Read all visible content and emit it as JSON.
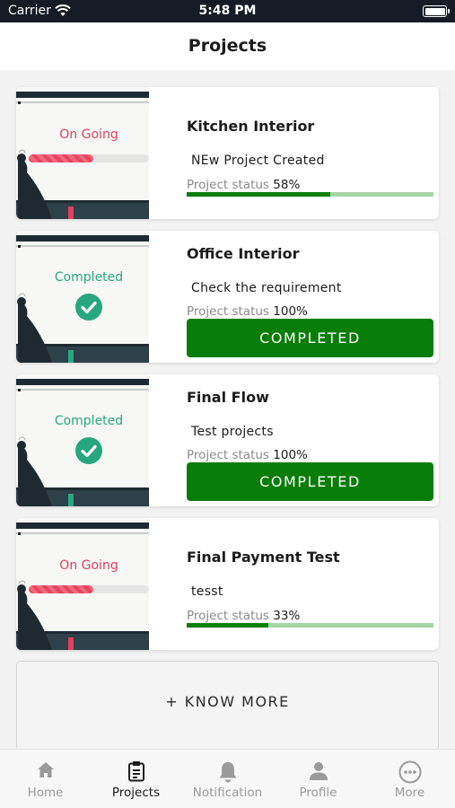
{
  "status_bar": {
    "carrier": "Carrier",
    "time": "5:48 PM"
  },
  "header": {
    "title": "Projects"
  },
  "status_label": "Project status",
  "projects": [
    {
      "title": "Kitchen Interior",
      "description": "NEw Project Created",
      "state": "On Going",
      "percent_text": "58%",
      "progress": 0.58,
      "completed": false
    },
    {
      "title": "Office Interior",
      "description": "Check the requirement",
      "state": "Completed",
      "percent_text": "100%",
      "progress": 1.0,
      "completed": true,
      "button_label": "COMPLETED"
    },
    {
      "title": "Final Flow",
      "description": "Test projects",
      "state": "Completed",
      "percent_text": "100%",
      "progress": 1.0,
      "completed": true,
      "button_label": "COMPLETED"
    },
    {
      "title": "Final Payment Test",
      "description": "tesst",
      "state": "On Going",
      "percent_text": "33%",
      "progress": 0.33,
      "completed": false
    }
  ],
  "know_more": {
    "label": "+ KNOW MORE"
  },
  "tabs": [
    {
      "label": "Home",
      "icon": "home-icon",
      "active": false
    },
    {
      "label": "Projects",
      "icon": "clipboard-icon",
      "active": true
    },
    {
      "label": "Notification",
      "icon": "bell-icon",
      "active": false
    },
    {
      "label": "Profile",
      "icon": "person-icon",
      "active": false
    },
    {
      "label": "More",
      "icon": "more-icon",
      "active": false
    }
  ],
  "colors": {
    "accent_green": "#087d08",
    "progress_track": "#a5d4a5",
    "ongoing_red": "#e0405e",
    "completed_teal": "#28a77e",
    "status_bar": "#151c25"
  }
}
